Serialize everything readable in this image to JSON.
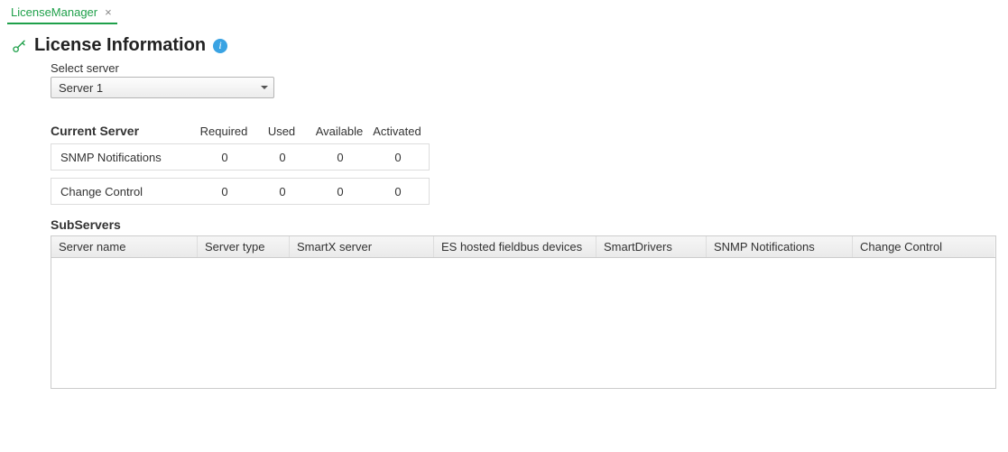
{
  "tab": {
    "label": "LicenseManager",
    "close": "×"
  },
  "page": {
    "title": "License Information"
  },
  "select": {
    "label": "Select server",
    "value": "Server 1"
  },
  "currentServer": {
    "title": "Current Server",
    "cols": {
      "required": "Required",
      "used": "Used",
      "available": "Available",
      "activated": "Activated"
    },
    "rows": [
      {
        "name": "SNMP Notifications",
        "required": "0",
        "used": "0",
        "available": "0",
        "activated": "0"
      },
      {
        "name": "Change Control",
        "required": "0",
        "used": "0",
        "available": "0",
        "activated": "0"
      }
    ]
  },
  "sub": {
    "title": "SubServers",
    "cols": {
      "c1": "Server name",
      "c2": "Server type",
      "c3": "SmartX server",
      "c4": "ES hosted fieldbus devices",
      "c5": "SmartDrivers",
      "c6": "SNMP Notifications",
      "c7": "Change Control"
    }
  }
}
